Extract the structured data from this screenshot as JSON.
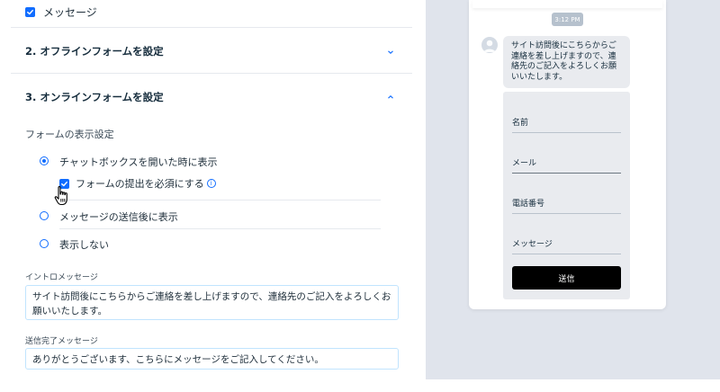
{
  "settings": {
    "message_checkbox_label": "メッセージ",
    "offline_section_title": "2. オフラインフォームを設定",
    "online_section_title": "3. オンラインフォームを設定",
    "display_settings_label": "フォームの表示設定",
    "options": [
      {
        "label": "チャットボックスを開いた時に表示",
        "selected": true
      },
      {
        "label": "メッセージの送信後に表示",
        "selected": false
      },
      {
        "label": "表示しない",
        "selected": false
      }
    ],
    "require_form_label": "フォームの提出を必須にする",
    "require_form_checked": true,
    "info_icon_glyph": "i",
    "intro_message_label": "イントロメッセージ",
    "intro_message_value": "サイト訪問後にこちらからご連絡を差し上げますので、連絡先のご記入をよろしくお願いいたします。",
    "completion_message_label": "送信完了メッセージ",
    "completion_message_value": "ありがとうございます、こちらにメッセージをご記入してください。"
  },
  "preview": {
    "timestamp": "3:12 PM",
    "bubble_text": "サイト訪問後にこちらからご連絡を差し上げますので、連絡先のご記入をよろしくお願いいたします。",
    "fields": [
      "名前",
      "メール",
      "電話番号",
      "メッセージ"
    ],
    "send_label": "送信"
  },
  "colors": {
    "accent": "#116dff",
    "panel_bg": "#e0e4ec",
    "bubble_bg": "#e9ebef",
    "send_button": "#000000"
  },
  "icons": [
    "checkbox-checked-icon",
    "chevron-down-icon",
    "chevron-up-icon",
    "info-icon",
    "hand-cursor-icon",
    "avatar-icon"
  ]
}
